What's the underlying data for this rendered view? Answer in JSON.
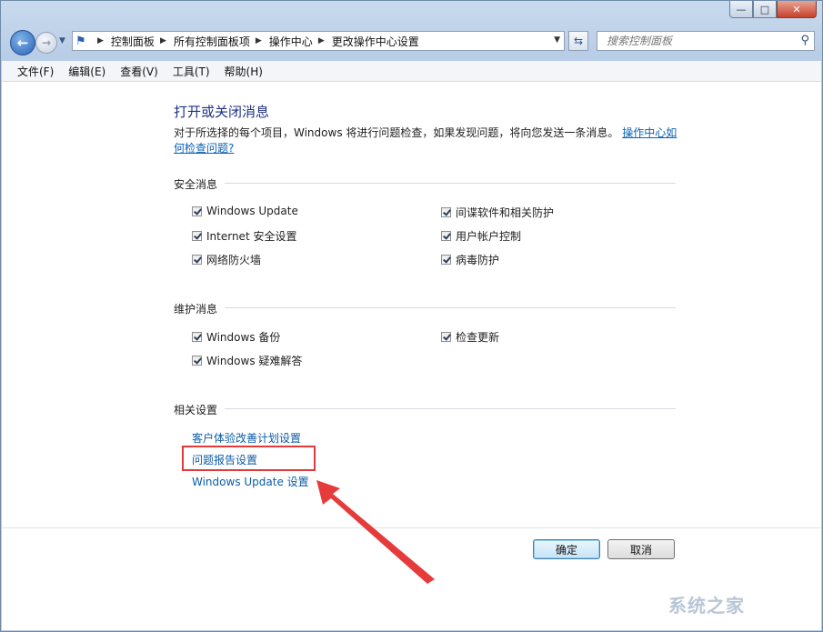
{
  "breadcrumb": [
    "控制面板",
    "所有控制面板项",
    "操作中心",
    "更改操作中心设置"
  ],
  "search": {
    "placeholder": "搜索控制面板"
  },
  "menu": [
    "文件(F)",
    "编辑(E)",
    "查看(V)",
    "工具(T)",
    "帮助(H)"
  ],
  "page": {
    "heading": "打开或关闭消息",
    "description": "对于所选择的每个项目，Windows 将进行问题检查，如果发现问题，将向您发送一条消息。",
    "description_link": "操作中心如何检查问题?"
  },
  "security": {
    "title": "安全消息",
    "items": [
      "Windows Update",
      "Internet 安全设置",
      "网络防火墙",
      "间谍软件和相关防护",
      "用户帐户控制",
      "病毒防护"
    ]
  },
  "maintenance": {
    "title": "维护消息",
    "items": [
      "Windows 备份",
      "Windows 疑难解答",
      "检查更新"
    ]
  },
  "related": {
    "title": "相关设置",
    "links": [
      "客户体验改善计划设置",
      "问题报告设置",
      "Windows Update 设置"
    ]
  },
  "buttons": {
    "ok": "确定",
    "cancel": "取消"
  },
  "watermark": "系统之家",
  "colors": {
    "link": "#0c5ca8",
    "heading": "#1e3287",
    "highlight": "#e23a3a"
  }
}
